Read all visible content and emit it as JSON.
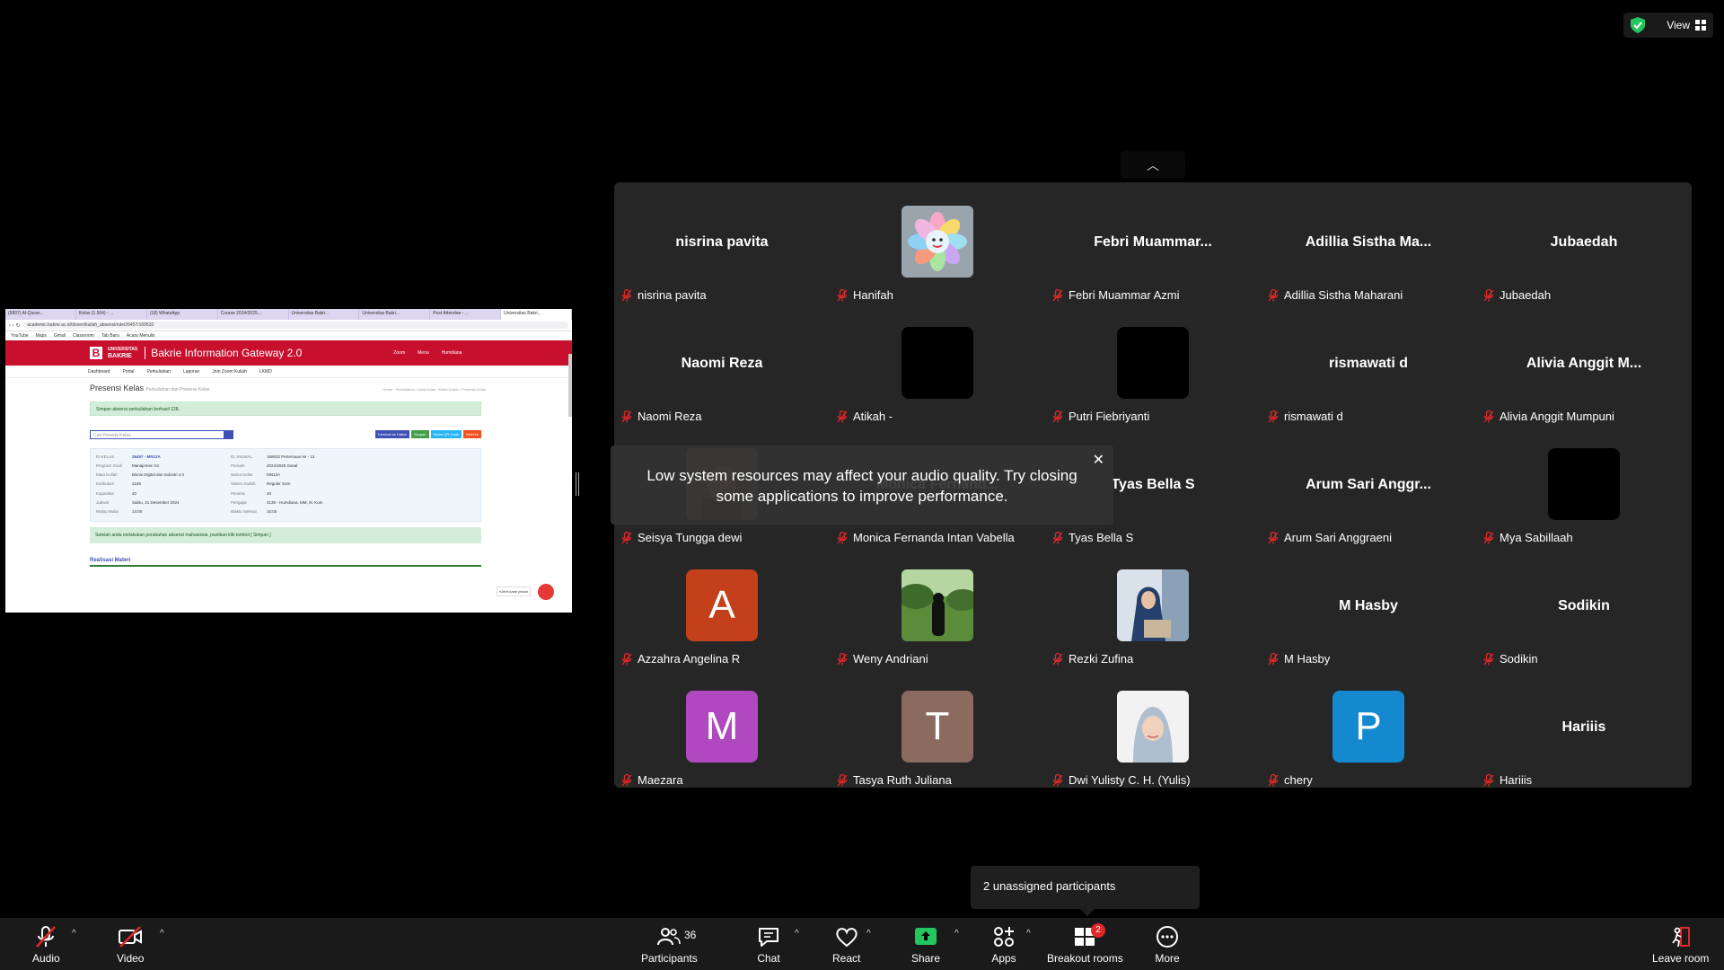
{
  "view": {
    "label": "View"
  },
  "toast": {
    "message": "Low system resources may affect your audio quality. Try closing some applications to improve performance."
  },
  "unassigned": {
    "text": "2 unassigned participants"
  },
  "share": {
    "tabs": [
      "(5897) Al-Quran...",
      "Kelas (1.504) - ...",
      "(18) WhatsApp",
      "Course 2024/2025...",
      "Universitas Bakri...",
      "Universitas Bakri...",
      "Post Attendee - ...",
      "Universitas Bakri..."
    ],
    "url": "academic.bakrie.ac.id/dosen/kuliah_absensi/rule/26457/169532",
    "bookmarks": [
      "YouTube",
      "Maps",
      "Gmail",
      "Classroom",
      "Tab Baru",
      "Acara Menulis"
    ],
    "logo_line1": "UNIVERSITAS",
    "logo_line2": "BAKRIE",
    "site_title": "Bakrie Information Gateway 2.0",
    "site_menu": [
      "Zoom",
      "Menu",
      "Humdiana"
    ],
    "nav": [
      "Dashboard",
      "Portal",
      "Perkuliahan",
      "Laporan",
      "Join Zoom Kuliah",
      "LKMD"
    ],
    "page_title": "Presensi Kelas",
    "page_subtitle": "Perkuliahan dan Presensi Kelas",
    "breadcrumb": "Home › Perkuliahan › Data Kelas › Kelas Kuliah › Presensi Kelas",
    "alert": "Simpan absensi perkuliahan berhasil 128.",
    "search_placeholder": "Cari Peserta Kelas",
    "buttons": [
      "Kembali ke Daftar",
      "Simpan",
      "Share QR Code",
      "Refresh"
    ],
    "info": [
      [
        "ID KELAS",
        "26457 - MN12A",
        "ID JADWAL",
        "169532 Pertemuan ke - 13"
      ],
      [
        "Program Studi",
        "Manajemen S1",
        "Periode",
        "2024/2025 Gasal"
      ],
      [
        "Mata Kuliah",
        "Bisnis Digital dan Industri 4.0",
        "Nama Kelas",
        "MN12A"
      ],
      [
        "Kurikulum",
        "2245",
        "Sistem Kuliah",
        "Reguler Sore"
      ],
      [
        "Kapasitas",
        "40",
        "Peserta",
        "40"
      ],
      [
        "Jadwal",
        "Sabtu, 21 Desember 2024",
        "Pengajar",
        "3139 - Humdiana, MM, M. Kom"
      ],
      [
        "Waktu Mulai",
        "14:00",
        "Waktu Selesai",
        "16:00"
      ]
    ],
    "note": "Setelah anda melakukan perubahan absensi mahasiswa, pastikan klik tombol [ Simpan ]",
    "realisasi": "Realisasi Materi",
    "chat_label": "Kirimi kami pesan"
  },
  "participants": [
    {
      "label": "nisrina pavita",
      "display": "nisrina pavita",
      "type": "name"
    },
    {
      "label": "Hanifah",
      "type": "image",
      "img": "flower"
    },
    {
      "label": "Febri Muammar Azmi",
      "display": "Febri  Muammar...",
      "type": "name"
    },
    {
      "label": "Adillia Sistha Maharani",
      "display": "Adillia  Sistha  Ma...",
      "type": "name"
    },
    {
      "label": "Jubaedah",
      "display": "Jubaedah",
      "type": "name"
    },
    {
      "label": "Naomi Reza",
      "display": "Naomi Reza",
      "type": "name"
    },
    {
      "label": "Atikah -",
      "type": "black"
    },
    {
      "label": "Putri Fiebriyanti",
      "type": "black"
    },
    {
      "label": "rismawati d",
      "display": "rismawati d",
      "type": "name"
    },
    {
      "label": "Alivia Anggit Mumpuni",
      "display": "Alivia  Anggit  M...",
      "type": "name"
    },
    {
      "label": "Seisya Tungga dewi",
      "type": "image",
      "img": "blur"
    },
    {
      "label": "Monica Fernanda Intan Vabella",
      "display": "Monica  Fernand...",
      "type": "name"
    },
    {
      "label": "Tyas Bella S",
      "display": "Tyas Bella S",
      "type": "name"
    },
    {
      "label": "Arum Sari Anggraeni",
      "display": "Arum  Sari  Anggr...",
      "type": "name"
    },
    {
      "label": "Mya Sabillaah",
      "type": "black"
    },
    {
      "label": "Azzahra Angelina R",
      "type": "letter",
      "letter": "A",
      "color": "#c3401a"
    },
    {
      "label": "Weny Andriani",
      "type": "image",
      "img": "landscape"
    },
    {
      "label": "Rezki Zufina",
      "type": "image",
      "img": "person-hijab"
    },
    {
      "label": "M Hasby",
      "display": "M Hasby",
      "type": "name"
    },
    {
      "label": "Sodikin",
      "display": "Sodikin",
      "type": "name"
    },
    {
      "label": "Maezara",
      "type": "letter",
      "letter": "M",
      "color": "#b049c0"
    },
    {
      "label": "Tasya Ruth Juliana",
      "type": "letter",
      "letter": "T",
      "color": "#8b6a60"
    },
    {
      "label": "Dwi Yulisty C. H. (Yulis)",
      "type": "image",
      "img": "portrait"
    },
    {
      "label": "chery",
      "type": "letter",
      "letter": "P",
      "color": "#1589d0"
    },
    {
      "label": "Hariiis",
      "display": "Hariiis",
      "type": "name"
    }
  ],
  "toolbar": {
    "audio": "Audio",
    "video": "Video",
    "participants": "Participants",
    "participants_count": "36",
    "chat": "Chat",
    "react": "React",
    "share": "Share",
    "apps": "Apps",
    "breakout": "Breakout rooms",
    "breakout_badge": "2",
    "more": "More",
    "leave": "Leave room"
  }
}
